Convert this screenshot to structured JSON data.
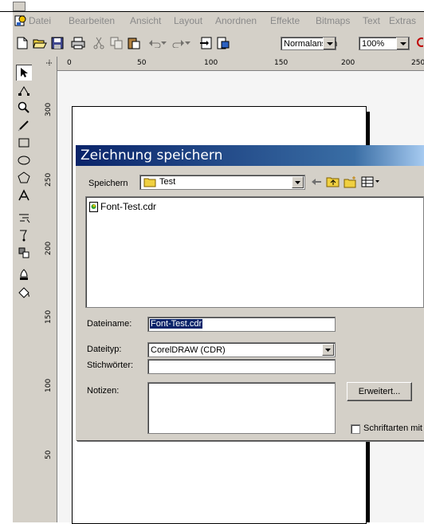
{
  "menubar": {
    "items": [
      "Datei",
      "Bearbeiten",
      "Ansicht",
      "Layout",
      "Anordnen",
      "Effekte",
      "Bitmaps",
      "Text",
      "Extras"
    ]
  },
  "toolbar": {
    "view_mode": "Normalansich",
    "zoom": "100%"
  },
  "rulers": {
    "horizontal_labels": [
      "0",
      "50",
      "100",
      "150",
      "200",
      "250"
    ],
    "vertical_labels": [
      "300",
      "250",
      "200",
      "150",
      "100",
      "50"
    ]
  },
  "dialog": {
    "title": "Zeichnung speichern",
    "save_in_label": "Speichern",
    "save_in_value": "Test",
    "files": [
      "Font-Test.cdr"
    ],
    "filename_label": "Dateiname:",
    "filename_value": "Font-Test.cdr",
    "filetype_label": "Dateityp:",
    "filetype_value": "CorelDRAW (CDR)",
    "keywords_label": "Stichwörter:",
    "notes_label": "Notizen:",
    "advanced_button": "Erweitert...",
    "fonts_checkbox_label": "Schriftarten mit T"
  }
}
